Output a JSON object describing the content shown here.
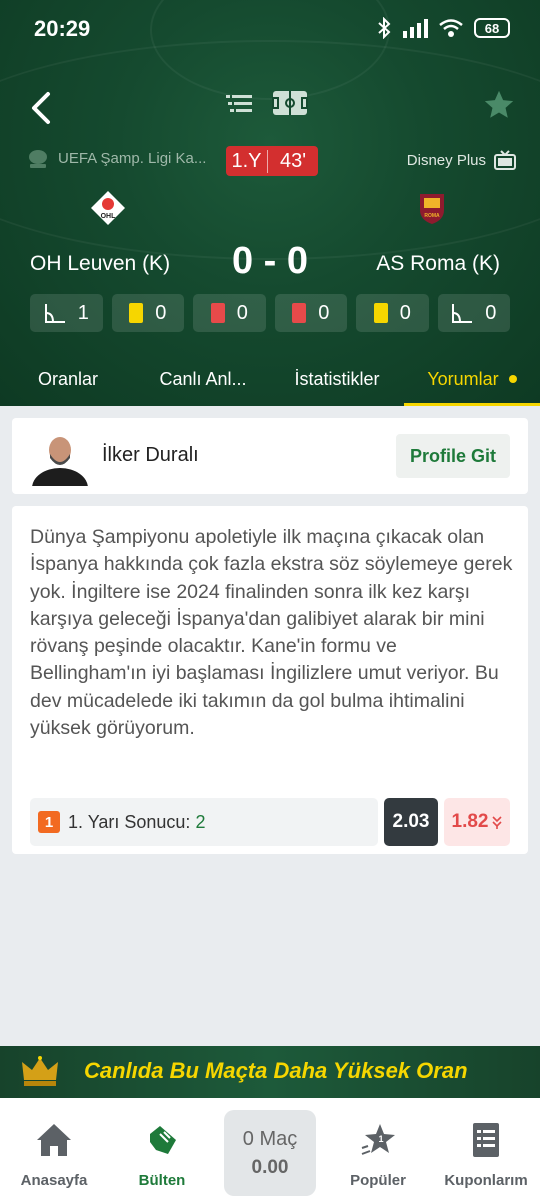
{
  "status_bar": {
    "time": "20:29",
    "battery": "68"
  },
  "match": {
    "league": "UEFA Şamp. Ligi Ka...",
    "half": "1.Y",
    "minute": "43'",
    "broadcaster": "Disney Plus",
    "home_team": "OH Leuven (K)",
    "away_team": "AS Roma (K)",
    "score": "0 - 0",
    "stats": [
      {
        "icon": "corner-flag-icon",
        "value": "1"
      },
      {
        "icon": "yellow-card-icon",
        "value": "0"
      },
      {
        "icon": "red-card-icon",
        "value": "0"
      },
      {
        "icon": "red-card-icon",
        "value": "0"
      },
      {
        "icon": "yellow-card-icon",
        "value": "0"
      },
      {
        "icon": "corner-flag-icon",
        "value": "0"
      }
    ]
  },
  "tabs": [
    {
      "label": "Oranlar"
    },
    {
      "label": "Canlı Anl..."
    },
    {
      "label": "İstatistikler"
    },
    {
      "label": "Yorumlar"
    }
  ],
  "active_tab": "Yorumlar",
  "author": {
    "name": "İlker Duralı",
    "profile_button": "Profile Git"
  },
  "comment": {
    "text": "Dünya Şampiyonu apoletiyle ilk maçına çıkacak olan İspanya hakkında çok fazla ekstra söz söylemeye gerek yok. İngiltere ise 2024 finalinden sonra ilk kez karşı karşıya geleceği İspanya'dan galibiyet alarak bir mini rövanş peşinde olacaktır. Kane'in formu ve Bellingham'ın iyi başlaması İngilizlere umut veriyor. Bu dev mücadelede iki takımın da gol bulma ihtimalini yüksek görüyorum.",
    "bet": {
      "number": "1",
      "market": "1. Yarı Sonucu:",
      "pick": "2",
      "odd": "2.03",
      "previous_odd": "1.82"
    }
  },
  "promo": {
    "text": "Canlıda Bu Maçta Daha Yüksek Oran"
  },
  "bottom_nav": {
    "home": "Anasayfa",
    "bulletin": "Bülten",
    "coupon_count": "0 Maç",
    "coupon_total": "0.00",
    "popular": "Popüler",
    "coupons": "Kuponlarım"
  },
  "colors": {
    "header_green": "#154a2f",
    "accent_yellow": "#f6d600",
    "live_red": "#d32f2f",
    "brand_green": "#1e7a3a"
  }
}
